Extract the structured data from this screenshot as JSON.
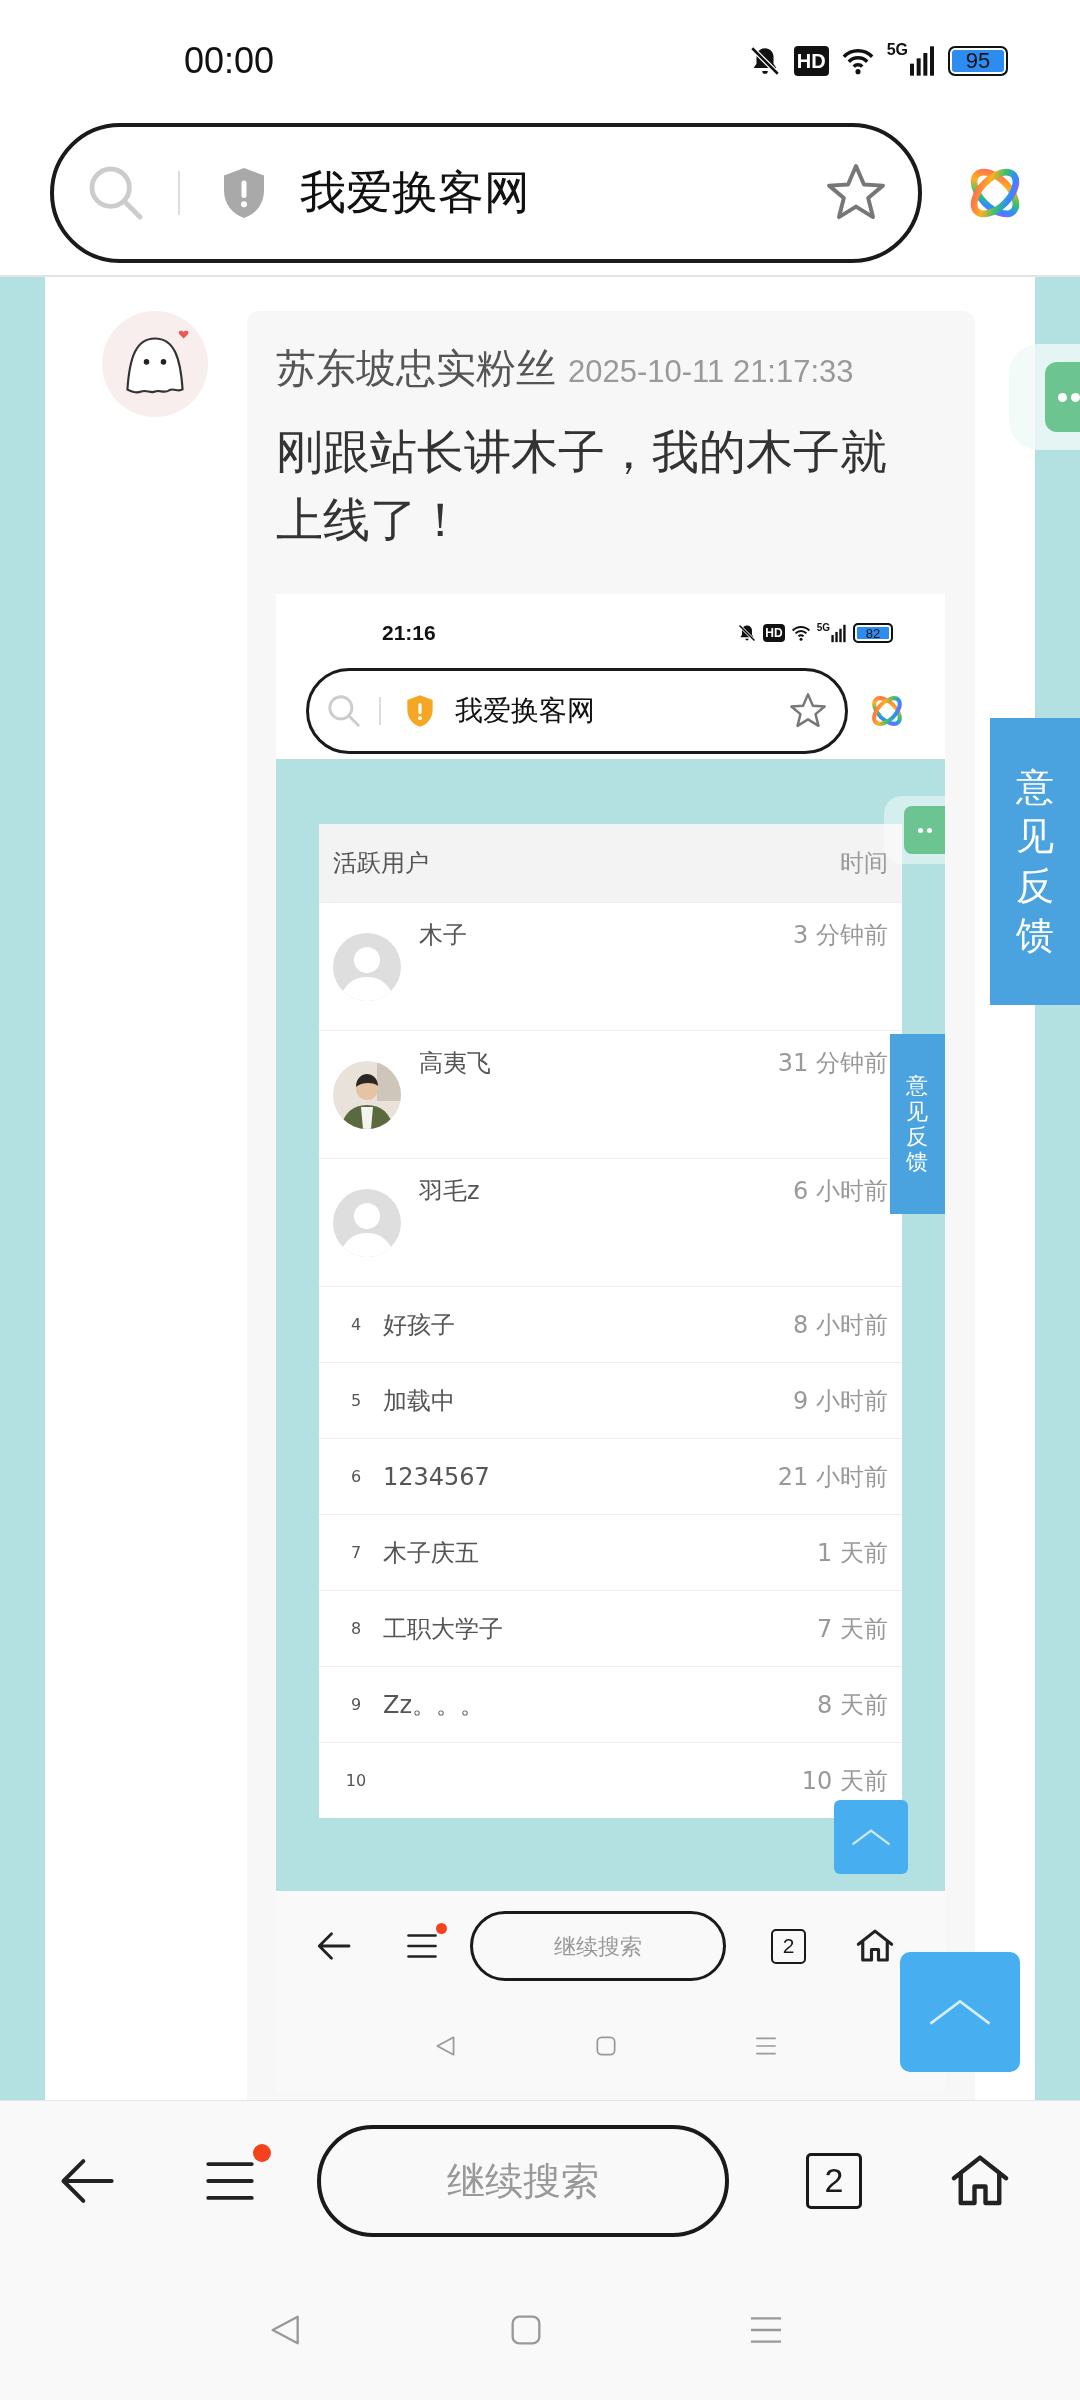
{
  "status_bar": {
    "time": "00:00",
    "hd_label": "HD",
    "network": "5G",
    "battery": "95"
  },
  "address_bar": {
    "title": "我爱换客网",
    "shield_warning": false
  },
  "comment": {
    "author": "苏东坡忠实粉丝",
    "date": "2025-10-11 21:17:33",
    "text": "刚跟站长讲木子，我的木子就上线了！",
    "screenshot": {
      "status_bar": {
        "time": "21:16",
        "hd_label": "HD",
        "network": "5G",
        "battery": "82"
      },
      "address_bar": {
        "title": "我爱换客网",
        "shield_warning": true
      },
      "table": {
        "columns": [
          "活跃用户",
          "时间"
        ],
        "rows": [
          {
            "kind": "avatar",
            "has_photo": false,
            "name": "木子",
            "time": "3 分钟前"
          },
          {
            "kind": "avatar",
            "has_photo": true,
            "name": "高夷飞",
            "time": "31 分钟前"
          },
          {
            "kind": "avatar",
            "has_photo": false,
            "name": "羽毛z",
            "time": "6 小时前"
          },
          {
            "kind": "ranked",
            "rank": "4",
            "name": "好孩子",
            "time": "8 小时前"
          },
          {
            "kind": "ranked",
            "rank": "5",
            "name": "加载中",
            "time": "9 小时前"
          },
          {
            "kind": "ranked",
            "rank": "6",
            "name": "1234567",
            "time": "21 小时前"
          },
          {
            "kind": "ranked",
            "rank": "7",
            "name": "木子庆五",
            "time": "1 天前"
          },
          {
            "kind": "ranked",
            "rank": "8",
            "name": "工职大学子",
            "time": "7 天前"
          },
          {
            "kind": "ranked",
            "rank": "9",
            "name": "Zz。。。",
            "time": "8 天前"
          },
          {
            "kind": "ranked",
            "rank": "10",
            "time": "10 天前"
          }
        ]
      },
      "feedback_tab": "意见反馈",
      "bottom_bar": {
        "placeholder": "继续搜索",
        "tab_count": "2",
        "menu_badge": true
      }
    }
  },
  "feedback_tab": "意见反馈",
  "bottom_bar": {
    "placeholder": "继续搜索",
    "tab_count": "2",
    "menu_badge": true
  }
}
